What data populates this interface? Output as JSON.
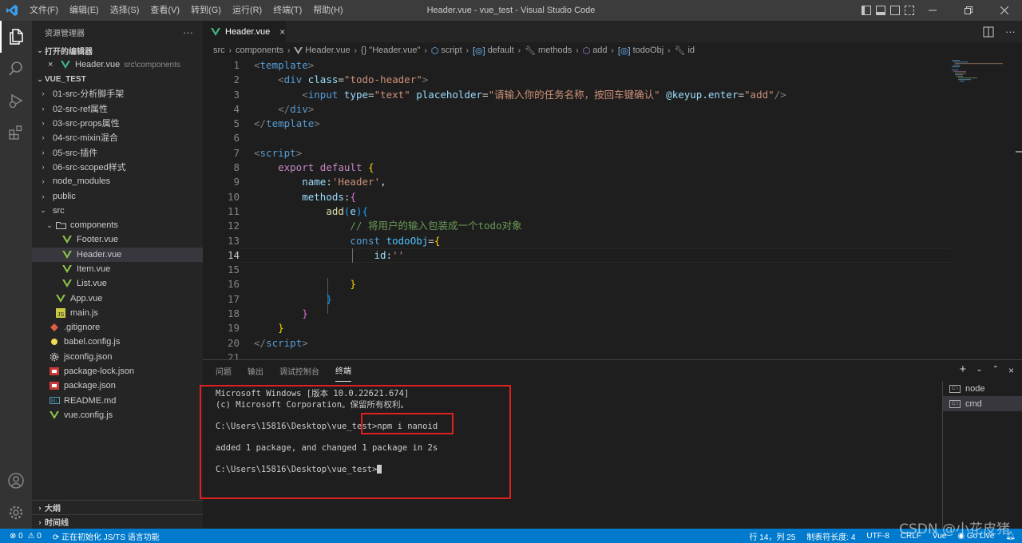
{
  "app": {
    "window_title": "Header.vue - vue_test - Visual Studio Code",
    "menu": [
      "文件(F)",
      "编辑(E)",
      "选择(S)",
      "查看(V)",
      "转到(G)",
      "运行(R)",
      "终端(T)",
      "帮助(H)"
    ],
    "accent": "#007acc"
  },
  "sidebar": {
    "title": "资源管理器",
    "more": "···",
    "open_editors_label": "打开的编辑器",
    "open_editor": {
      "name": "Header.vue",
      "path": "src\\components"
    },
    "project_label": "VUE_TEST",
    "tree": [
      {
        "name": "01-src-分析脚手架",
        "type": "folder",
        "chev": "›"
      },
      {
        "name": "02-src-ref属性",
        "type": "folder",
        "chev": "›"
      },
      {
        "name": "03-src-props属性",
        "type": "folder",
        "chev": "›"
      },
      {
        "name": "04-src-mixin混合",
        "type": "folder",
        "chev": "›"
      },
      {
        "name": "05-src-插件",
        "type": "folder",
        "chev": "›"
      },
      {
        "name": "06-src-scoped样式",
        "type": "folder",
        "chev": "›"
      },
      {
        "name": "node_modules",
        "type": "folder",
        "chev": "›"
      },
      {
        "name": "public",
        "type": "folder",
        "chev": "›"
      },
      {
        "name": "src",
        "type": "folder-open",
        "chev": "⌄"
      },
      {
        "name": "components",
        "type": "folder-open",
        "chev": "⌄"
      },
      {
        "name": "Footer.vue",
        "type": "vue"
      },
      {
        "name": "Header.vue",
        "type": "vue"
      },
      {
        "name": "Item.vue",
        "type": "vue"
      },
      {
        "name": "List.vue",
        "type": "vue"
      },
      {
        "name": "App.vue",
        "type": "vue"
      },
      {
        "name": "main.js",
        "type": "js"
      },
      {
        "name": ".gitignore",
        "type": "git"
      },
      {
        "name": "babel.config.js",
        "type": "babel"
      },
      {
        "name": "jsconfig.json",
        "type": "gear"
      },
      {
        "name": "package-lock.json",
        "type": "npm"
      },
      {
        "name": "package.json",
        "type": "npm"
      },
      {
        "name": "README.md",
        "type": "md"
      },
      {
        "name": "vue.config.js",
        "type": "vue"
      }
    ],
    "outline_label": "大纲",
    "timeline_label": "时间线"
  },
  "editor": {
    "tab_label": "Header.vue",
    "breadcrumbs": [
      "src",
      "components",
      "Header.vue",
      "{} \"Header.vue\"",
      "script",
      "default",
      "methods",
      "add",
      "todoObj",
      "id"
    ],
    "line_numbers": [
      "1",
      "2",
      "3",
      "4",
      "5",
      "6",
      "7",
      "8",
      "9",
      "10",
      "11",
      "12",
      "13",
      "14",
      "15",
      "16",
      "17",
      "18",
      "19",
      "20",
      "21"
    ],
    "current_line": "14",
    "code": {
      "l1_tag": "template",
      "l2_tag": "div",
      "l2_attr": "class",
      "l2_val": "\"todo-header\"",
      "l3_tag": "input",
      "l3_attr1": "type",
      "l3_val1": "\"text\"",
      "l3_attr2": "placeholder",
      "l3_val2": "\"请输入你的任务名称，按回车键确认\"",
      "l3_attr3": "@keyup.enter",
      "l3_val3": "\"add\"",
      "l4_tag": "div",
      "l5_tag": "template",
      "l7_tag": "script",
      "l8_kw1": "export",
      "l8_kw2": "default",
      "l9_key": "name",
      "l9_val": "'Header'",
      "l10_key": "methods",
      "l11_fn": "add",
      "l11_param": "e",
      "l12_comment": "// 将用户的输入包装成一个todo对象",
      "l13_kw": "const",
      "l13_var": "todoObj",
      "l14_key": "id",
      "l14_val": "''",
      "l20_tag": "script"
    }
  },
  "panel": {
    "tabs": [
      "问题",
      "输出",
      "调试控制台",
      "终端"
    ],
    "active_tab": "终端",
    "terminal_lines": [
      "Microsoft Windows [版本 10.0.22621.674]",
      "(c) Microsoft Corporation。保留所有权利。",
      "",
      "C:\\Users\\15816\\Desktop\\vue_test>npm i nanoid",
      "",
      "added 1 package, and changed 1 package in 2s",
      "",
      "C:\\Users\\15816\\Desktop\\vue_test>"
    ],
    "terminals": [
      "node",
      "cmd"
    ],
    "active_terminal": "cmd"
  },
  "statusbar": {
    "errors": "0",
    "warnings": "0",
    "task": "正在初始化 JS/TS 语言功能",
    "position": "行 14，列 25",
    "tab_size": "制表符长度: 4",
    "encoding": "UTF-8",
    "eol": "CRLF",
    "language": "Vue",
    "go_live": "Go Live"
  },
  "watermark": "CSDN @小花皮猪"
}
